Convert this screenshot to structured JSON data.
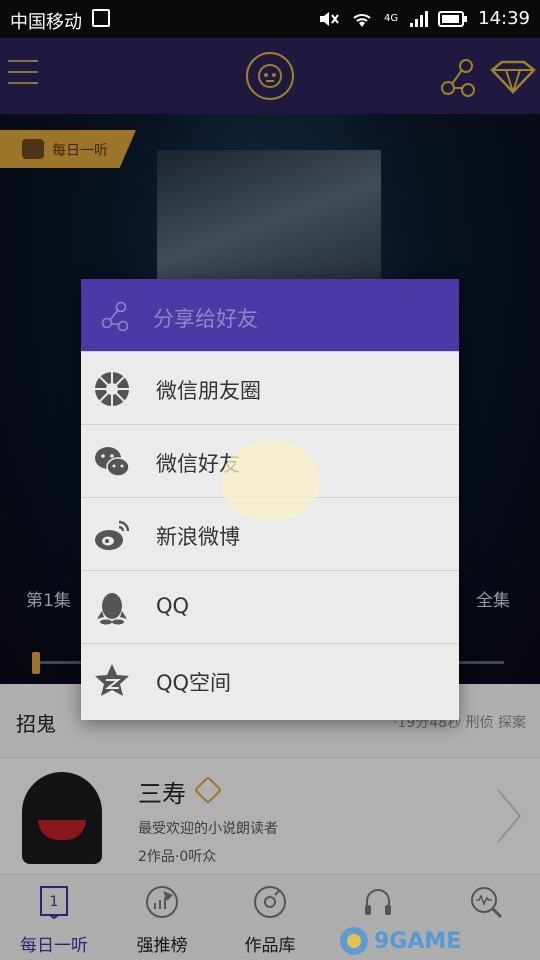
{
  "status_bar": {
    "carrier": "中国移动",
    "network": "4G",
    "time": "14:39"
  },
  "header": {
    "menu_icon": "hamburger-icon",
    "logo_icon": "headphones-logo-icon",
    "share_icon": "share-icon",
    "vip_icon": "diamond-icon"
  },
  "main": {
    "daily_tag": "每日一听",
    "episode_first": "第1集",
    "episode_all": "全集",
    "progress": 0.0
  },
  "story": {
    "title": "招鬼",
    "meta": "·19分48秒 刑侦 探案"
  },
  "author": {
    "name": "三寿",
    "description": "最受欢迎的小说朗读者",
    "stats": "2作品·0听众"
  },
  "nav": {
    "items": [
      {
        "label": "每日一听",
        "icon": "book-icon"
      },
      {
        "label": "强推榜",
        "icon": "rocket-chart-icon"
      },
      {
        "label": "作品库",
        "icon": "disc-icon"
      },
      {
        "label": "",
        "icon": "headset-icon"
      },
      {
        "label": "",
        "icon": "search-wave-icon"
      }
    ]
  },
  "share_dialog": {
    "title": "分享给好友",
    "options": [
      {
        "label": "微信朋友圈",
        "icon": "wechat-moments-icon"
      },
      {
        "label": "微信好友",
        "icon": "wechat-icon"
      },
      {
        "label": "新浪微博",
        "icon": "weibo-icon"
      },
      {
        "label": "QQ",
        "icon": "qq-icon"
      },
      {
        "label": "QQ空间",
        "icon": "qzone-icon"
      }
    ]
  },
  "watermark": {
    "text": "9GAME"
  },
  "colors": {
    "header": "#2b2358",
    "dialog_header": "#4b39a6",
    "accent": "#d8a23c"
  }
}
